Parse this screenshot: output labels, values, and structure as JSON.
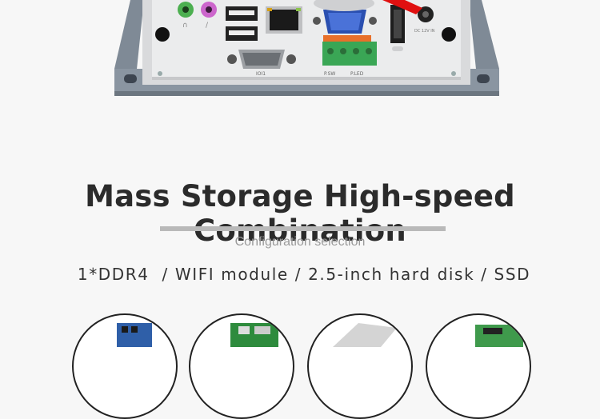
{
  "product_image": {
    "port_labels": {
      "com": "IOI1",
      "power_switch": "P.SW",
      "power_led": "P.LED",
      "dc_in": "DC 12V IN"
    }
  },
  "section": {
    "headline": "Mass Storage High-speed Combination",
    "subtitle": "Configuration selection",
    "options_line": "1*DDR4  / WIFI module / 2.5-inch hard disk / SSD"
  },
  "option_thumbnails": [
    {
      "icon": "ddr4-memory-icon"
    },
    {
      "icon": "wifi-module-icon"
    },
    {
      "icon": "hard-disk-icon"
    },
    {
      "icon": "ssd-icon"
    }
  ],
  "colors": {
    "background": "#f7f7f7",
    "headline": "#2b2b2b",
    "subtitle": "#9a9a9a",
    "rule": "#b9b9b9",
    "accent_red": "#e01010"
  }
}
